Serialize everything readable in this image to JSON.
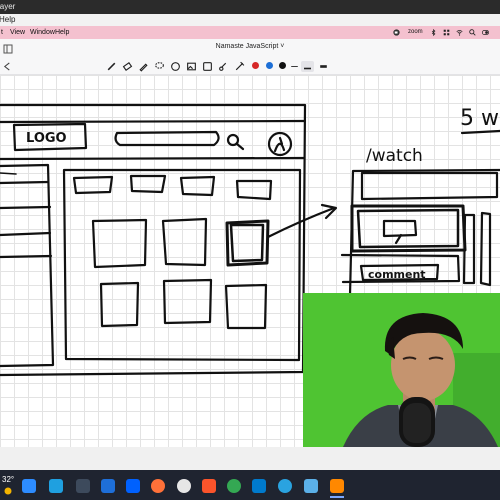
{
  "window": {
    "player_title": "layer",
    "help_label": "Help"
  },
  "menubar": {
    "items": [
      "t",
      "View",
      "Window",
      "Help"
    ],
    "accent": "#f4c1cf",
    "status_icons": [
      "zoom-icon",
      "bluetooth-icon",
      "grid-icon",
      "wifi-icon",
      "search-icon",
      "toggle-icon"
    ],
    "zoom_label": "zoom"
  },
  "app": {
    "doc_title": "Namaste JavaScript ˅"
  },
  "toolbar": {
    "tools": [
      "pen-icon",
      "eraser-icon",
      "highlighter-icon",
      "lasso-icon",
      "shape-icon",
      "image-icon",
      "sticker-icon",
      "link-icon"
    ],
    "colors": [
      "#d62828",
      "#1d6fd6",
      "#111111"
    ]
  },
  "sketch": {
    "logo_text": "LOGO",
    "watch_text": "/watch",
    "comment_text": "comment",
    "corner_text": "5 w"
  },
  "taskbar": {
    "temperature": "32°",
    "icons": [
      "start-icon",
      "search-icon",
      "zoom-app-icon",
      "edge-icon",
      "camera-icon",
      "store-icon",
      "dropbox-icon",
      "firefox-icon",
      "github-icon",
      "brave-icon",
      "chrome-icon",
      "vscode-icon",
      "telegram-icon",
      "photos-icon",
      "vlc-icon"
    ]
  }
}
